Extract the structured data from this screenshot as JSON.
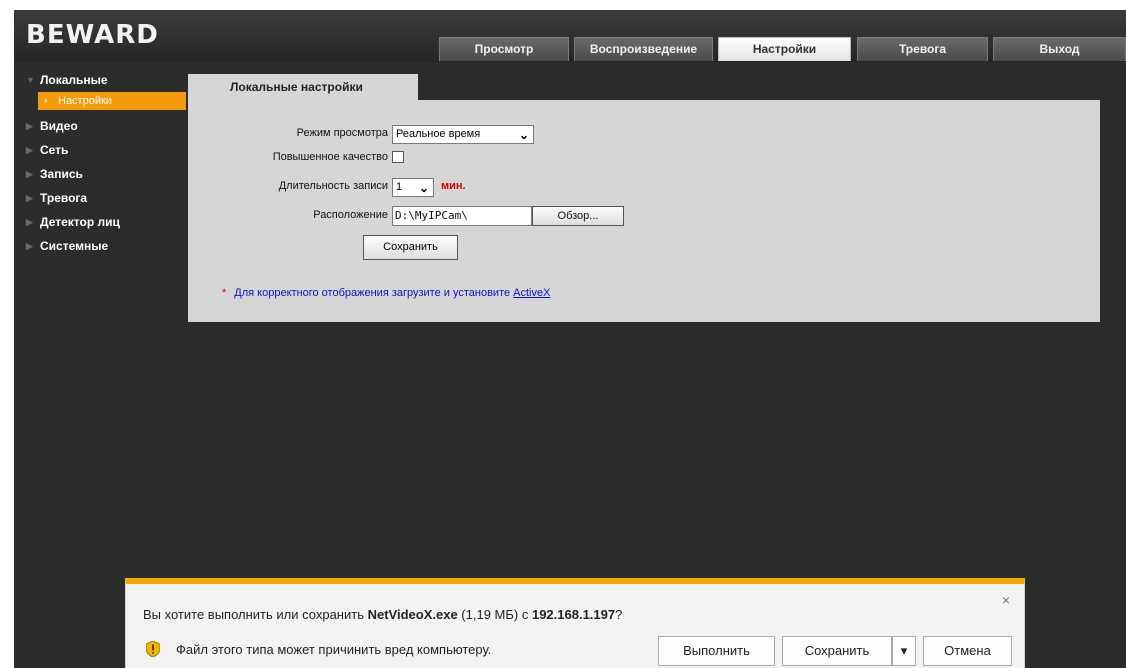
{
  "app": {
    "logo": "BEWARD"
  },
  "nav": {
    "tabs": [
      {
        "label": "Просмотр"
      },
      {
        "label": "Воспроизведение"
      },
      {
        "label": "Настройки",
        "active": true
      },
      {
        "label": "Тревога"
      },
      {
        "label": "Выход"
      }
    ]
  },
  "sidebar": {
    "items": [
      {
        "label": "Локальные",
        "expanded": true
      },
      {
        "label": "Настройки",
        "selected": true
      },
      {
        "label": "Видео"
      },
      {
        "label": "Сеть"
      },
      {
        "label": "Запись"
      },
      {
        "label": "Тревога"
      },
      {
        "label": "Детектор лиц"
      },
      {
        "label": "Системные"
      }
    ]
  },
  "content": {
    "tab_title": "Локальные настройки",
    "view_mode": {
      "label": "Режим просмотра",
      "value": "Реальное время"
    },
    "high_quality": {
      "label": "Повышенное качество",
      "checked": false
    },
    "record_duration": {
      "label": "Длительность записи",
      "value": "1",
      "unit": "мин."
    },
    "location": {
      "label": "Расположение",
      "value": "D:\\MyIPCam\\",
      "browse_label": "Обзор..."
    },
    "save_label": "Сохранить",
    "note": {
      "star": "*",
      "text": "Для корректного отображения загрузите и установите ",
      "link": "ActiveX"
    }
  },
  "download_bar": {
    "question_prefix": "Вы хотите выполнить или сохранить ",
    "file_name": "NetVideoX.exe",
    "file_size": " (1,19 МБ) с ",
    "host": "192.168.1.197",
    "question_suffix": "?",
    "warning": "Файл этого типа может причинить вред компьютеру.",
    "run_label": "Выполнить",
    "save_label": "Сохранить",
    "cancel_label": "Отмена",
    "accent_color": "#f2a900"
  },
  "colors": {
    "background": "#2c2c2c",
    "panel": "#d6d6d6",
    "selected": "#f59a0b"
  }
}
